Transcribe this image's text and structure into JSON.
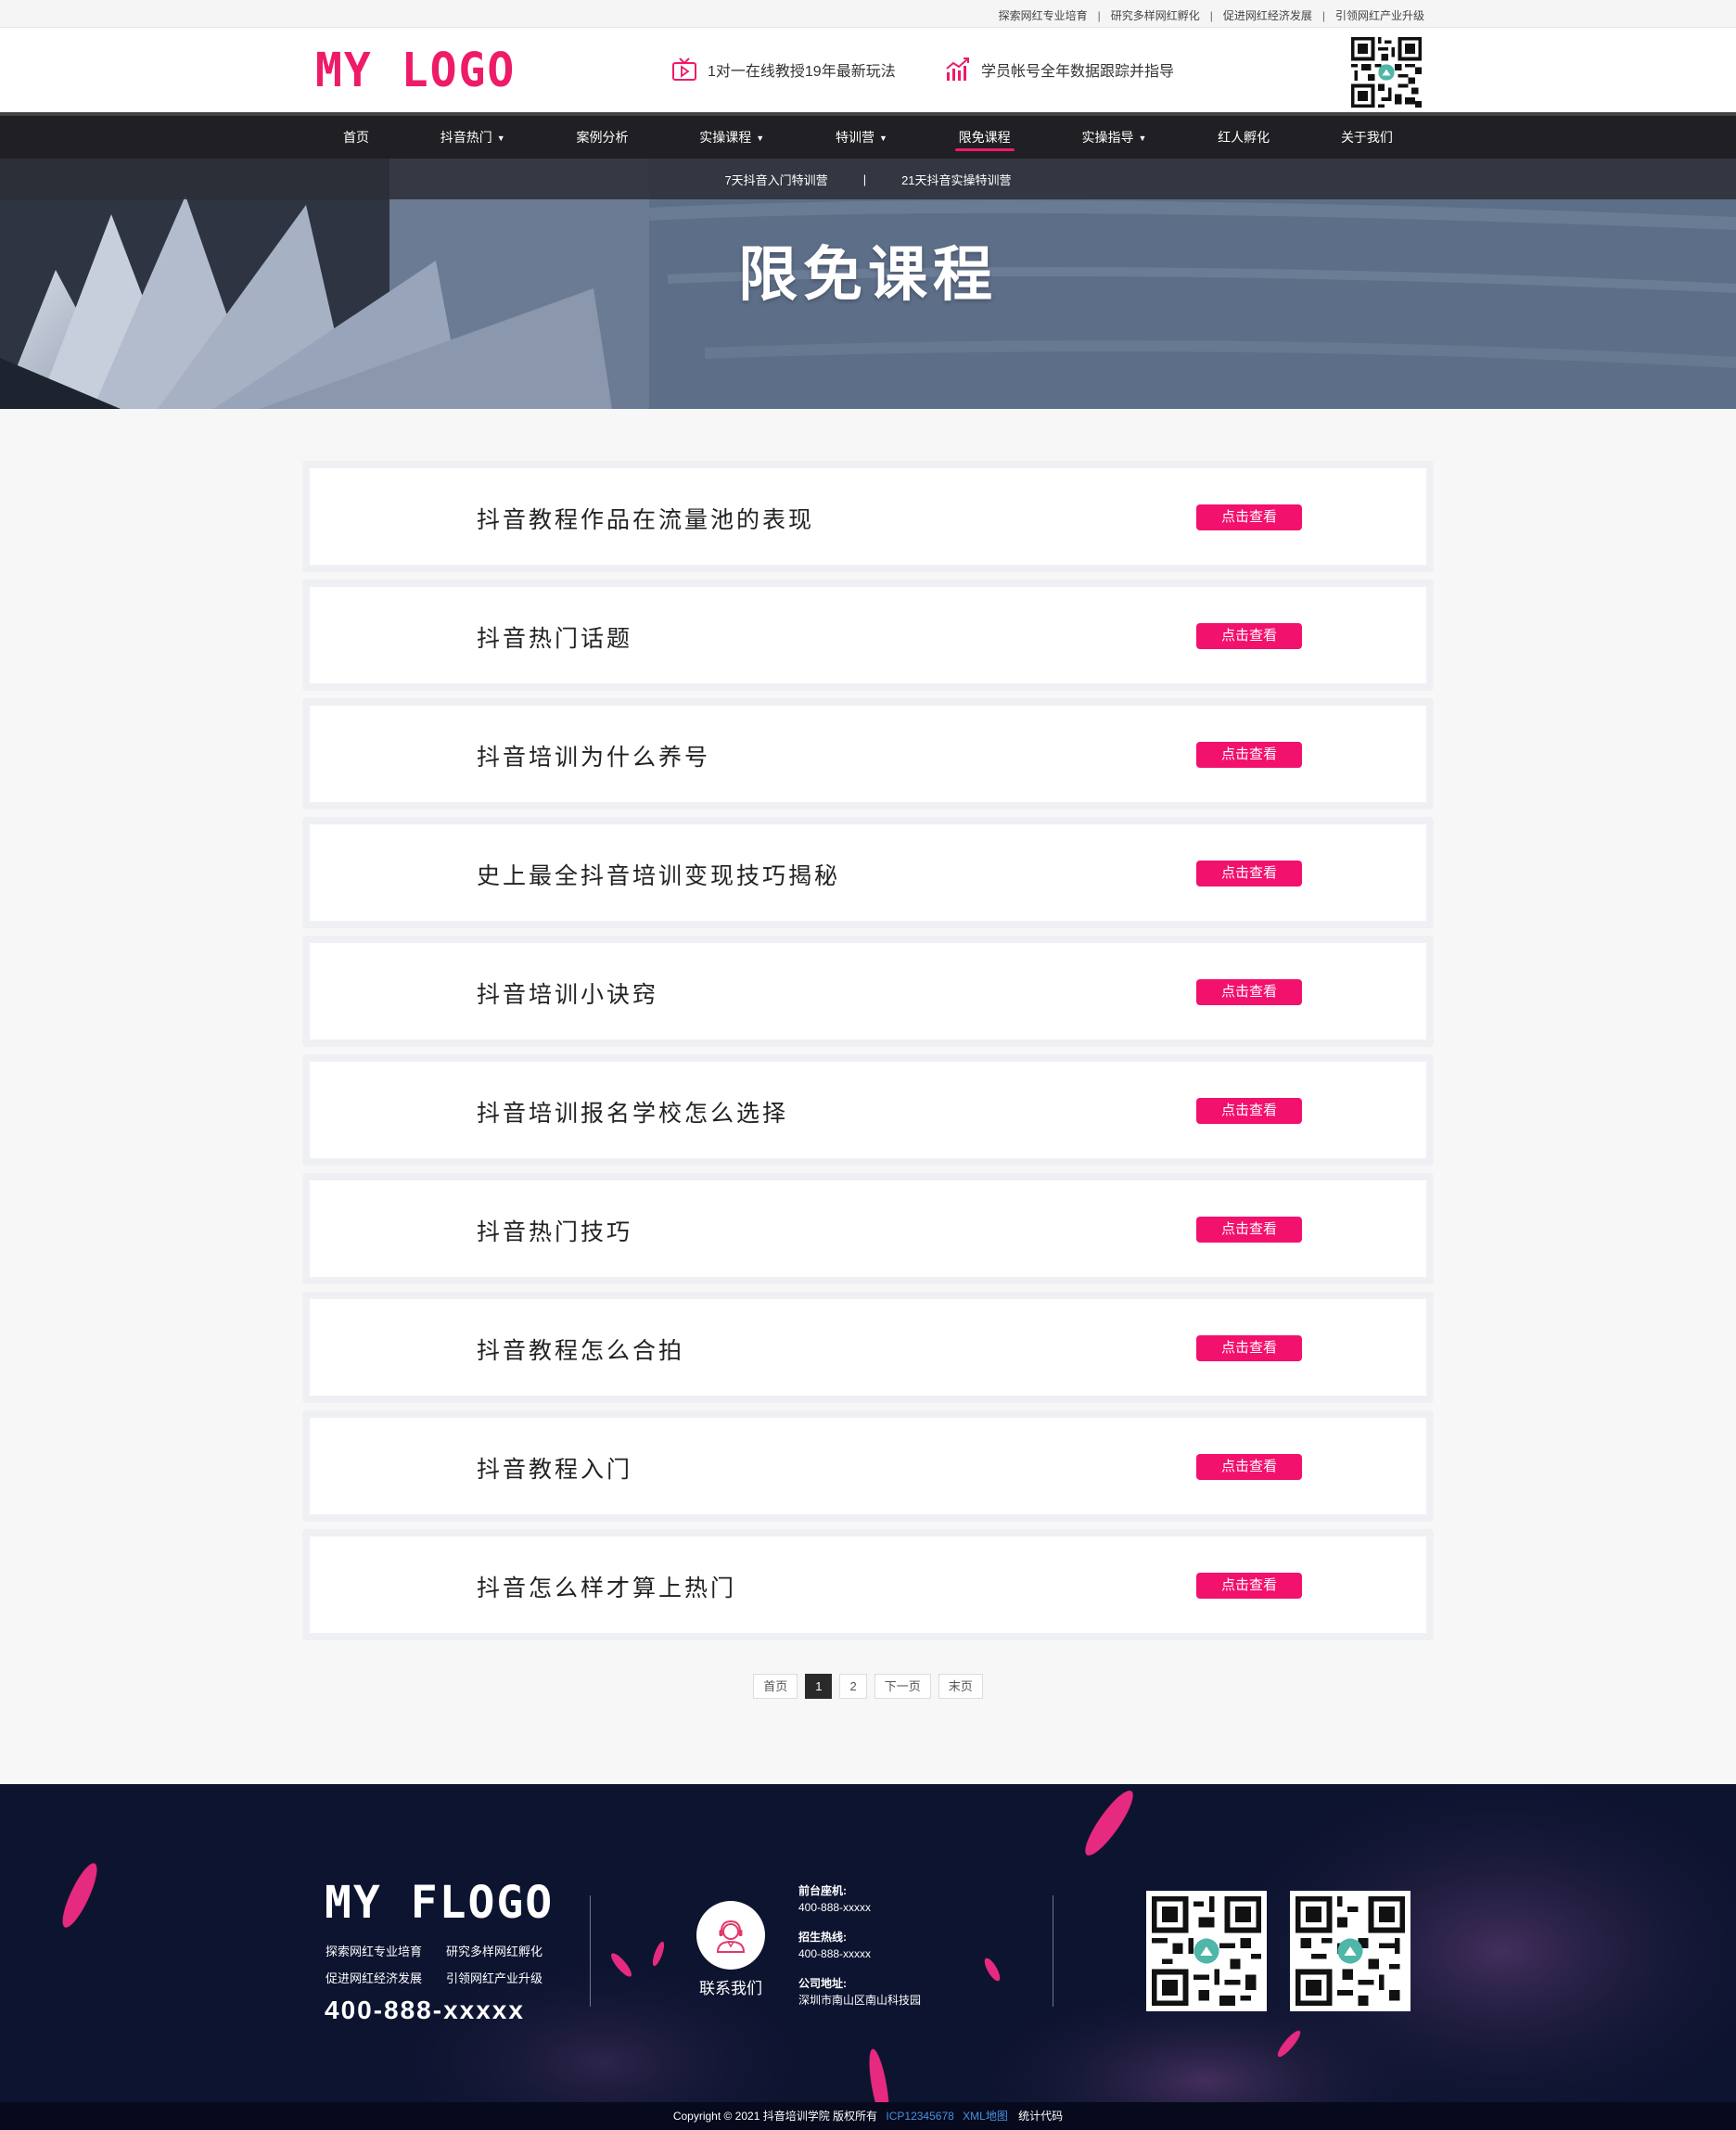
{
  "topbar": {
    "links": [
      "探索网红专业培育",
      "研究多样网红孵化",
      "促进网红经济发展",
      "引领网红产业升级"
    ],
    "separator": "|"
  },
  "header": {
    "logo": "MY LOGO",
    "features": [
      {
        "icon": "tv-play-icon",
        "text": "1对一在线教授19年最新玩法"
      },
      {
        "icon": "growth-chart-icon",
        "text": "学员帐号全年数据跟踪并指导"
      }
    ]
  },
  "nav": {
    "items": [
      {
        "label": "首页",
        "dropdown": false
      },
      {
        "label": "抖音热门",
        "dropdown": true
      },
      {
        "label": "案例分析",
        "dropdown": false
      },
      {
        "label": "实操课程",
        "dropdown": true
      },
      {
        "label": "特训营",
        "dropdown": true
      },
      {
        "label": "限免课程",
        "dropdown": false,
        "active": true
      },
      {
        "label": "实操指导",
        "dropdown": true
      },
      {
        "label": "红人孵化",
        "dropdown": false
      },
      {
        "label": "关于我们",
        "dropdown": false
      }
    ],
    "caret": "▼"
  },
  "banner": {
    "sub_links": [
      "7天抖音入门特训营",
      "21天抖音实操特训营"
    ],
    "sub_separator": "|",
    "title": "限免课程"
  },
  "courses": {
    "button_label": "点击查看",
    "items": [
      "抖音教程作品在流量池的表现",
      "抖音热门话题",
      "抖音培训为什么养号",
      "史上最全抖音培训变现技巧揭秘",
      "抖音培训小诀窍",
      "抖音培训报名学校怎么选择",
      "抖音热门技巧",
      "抖音教程怎么合拍",
      "抖音教程入门",
      "抖音怎么样才算上热门"
    ]
  },
  "pagination": {
    "first": "首页",
    "pages": [
      "1",
      "2"
    ],
    "current": "1",
    "next": "下一页",
    "last": "末页"
  },
  "footer": {
    "logo": "MY FLOGO",
    "tags": [
      "探索网红专业培育",
      "研究多样网红孵化",
      "促进网红经济发展",
      "引领网红产业升级"
    ],
    "phone": "400-888-xxxxx",
    "contact_label": "联系我们",
    "info": [
      {
        "label": "前台座机:",
        "value": "400-888-xxxxx"
      },
      {
        "label": "招生热线:",
        "value": "400-888-xxxxx"
      },
      {
        "label": "公司地址:",
        "value": "深圳市南山区南山科技园"
      }
    ],
    "copyright": "Copyright © 2021 抖音培训学院 版权所有",
    "icp": "ICP12345678",
    "xml_map": "XML地图",
    "stats": "统计代码"
  },
  "colors": {
    "accent": "#ee1b69",
    "nav_bg": "#1f1f24",
    "footer_bg": "#0d1430"
  }
}
